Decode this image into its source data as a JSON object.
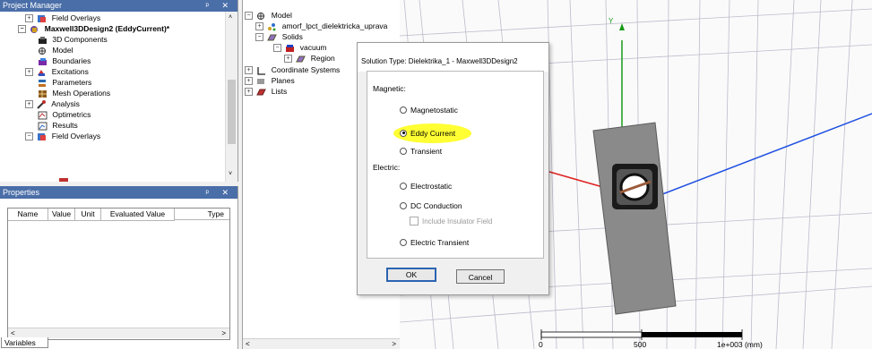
{
  "project_manager": {
    "title": "Project Manager",
    "title_buttons": "ᵖ ✕",
    "tree": [
      {
        "label": "Field Overlays",
        "icon": "field-overlays-icon"
      },
      {
        "label": "Maxwell3DDesign2 (EddyCurrent)*",
        "icon": "design-icon"
      },
      {
        "label": "3D Components",
        "icon": "components-icon"
      },
      {
        "label": "Model",
        "icon": "model-icon"
      },
      {
        "label": "Boundaries",
        "icon": "boundaries-icon"
      },
      {
        "label": "Excitations",
        "icon": "excitations-icon"
      },
      {
        "label": "Parameters",
        "icon": "parameters-icon"
      },
      {
        "label": "Mesh Operations",
        "icon": "mesh-icon"
      },
      {
        "label": "Analysis",
        "icon": "analysis-icon"
      },
      {
        "label": "Optimetrics",
        "icon": "optimetrics-icon"
      },
      {
        "label": "Results",
        "icon": "results-icon"
      },
      {
        "label": "Field Overlays",
        "icon": "field-overlays-icon"
      }
    ]
  },
  "properties": {
    "title": "Properties",
    "title_buttons": "ᵖ ✕",
    "columns": [
      "Name",
      "Value",
      "Unit",
      "Evaluated Value",
      "Type"
    ],
    "tab": "Variables"
  },
  "model_tree": {
    "items": [
      {
        "label": "Model"
      },
      {
        "label": "amorf_lpct_dielektricka_uprava"
      },
      {
        "label": "Solids"
      },
      {
        "label": "vacuum"
      },
      {
        "label": "Region"
      },
      {
        "label": "Coordinate Systems"
      },
      {
        "label": "Planes"
      },
      {
        "label": "Lists"
      }
    ]
  },
  "viewport": {
    "axis_y_label": "Y",
    "scale": {
      "tick0": "0",
      "tick1": "500",
      "tick2": "1e+003 (mm)"
    },
    "colors": {
      "y_axis": "#1a9a1a",
      "z_axis": "#1f4fe0",
      "x_axis": "#e02020",
      "plate": "#8a8a8a",
      "grid": "#b8b8c8"
    }
  },
  "dialog": {
    "title": "Solution Type: Dielektrika_1 - Maxwell3DDesign2",
    "magnetic_label": "Magnetic:",
    "electric_label": "Electric:",
    "options": {
      "magnetostatic": "Magnetostatic",
      "eddy_current": "Eddy Current",
      "transient": "Transient",
      "electrostatic": "Electrostatic",
      "dc_conduction": "DC Conduction",
      "include_insulator": "Include Insulator Field",
      "electric_transient": "Electric Transient"
    },
    "selected": "Eddy Current",
    "highlight_color": "#ffff33",
    "ok_label": "OK",
    "cancel_label": "Cancel"
  }
}
